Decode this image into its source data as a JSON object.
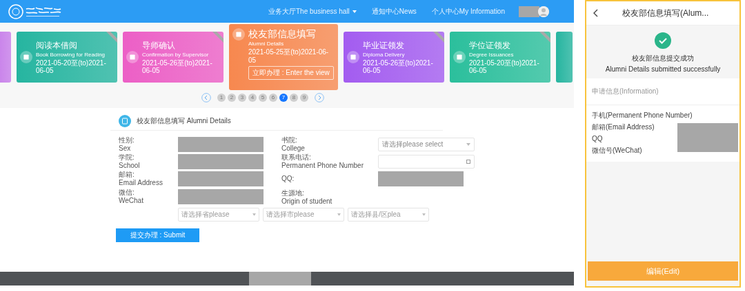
{
  "nav": {
    "items": [
      {
        "label": "业务大厅The business hall",
        "dropdown": true
      },
      {
        "label": "通知中心News",
        "dropdown": false
      },
      {
        "label": "个人中心My Information",
        "dropdown": false
      }
    ]
  },
  "carousel": {
    "cards": [
      {
        "kind": "fragment",
        "color": "#c77dea",
        "selected": false
      },
      {
        "title": "阅读本借阅",
        "subtitle": "Book Borrowing for Reading",
        "date": "2021-05-20至(to)2021-06-05",
        "color": "#26b5a0",
        "selected": false,
        "kind": "card"
      },
      {
        "title": "导师确认",
        "subtitle": "Confirmation by Supervisor",
        "date": "2021-05-26至(to)2021-06-05",
        "color": "#ec5fc6",
        "selected": false,
        "kind": "card"
      },
      {
        "title": "校友部信息填写",
        "subtitle": "Alumni Details",
        "date": "2021-05-25至(to)2021-06-05",
        "color": "#f7884f",
        "selected": true,
        "kind": "card",
        "action": "立即办理 : Enter the view"
      },
      {
        "title": "毕业证领发",
        "subtitle": "Diploma Delivery",
        "date": "2021-05-26至(to)2021-06-05",
        "color": "#a35cf0",
        "selected": false,
        "kind": "card"
      },
      {
        "title": "学位证领发",
        "subtitle": "Degree Issuances",
        "date": "2021-05-20至(to)2021-06-05",
        "color": "#2bbf9c",
        "selected": false,
        "kind": "card"
      },
      {
        "kind": "fragment",
        "color": "#26b5a0",
        "selected": false
      }
    ],
    "pages": [
      {
        "label": "1",
        "selected": false
      },
      {
        "label": "2",
        "selected": false
      },
      {
        "label": "3",
        "selected": false
      },
      {
        "label": "4",
        "selected": false
      },
      {
        "label": "5",
        "selected": false
      },
      {
        "label": "6",
        "selected": false
      },
      {
        "label": "7",
        "selected": true
      },
      {
        "label": "8",
        "selected": false
      },
      {
        "label": "9",
        "selected": false
      }
    ]
  },
  "form": {
    "title": "校友部信息填写 Alumni Details",
    "fields": [
      {
        "label": "性别:",
        "label_en": "Sex",
        "kind": "select",
        "redacted": true
      },
      {
        "label": "书院:",
        "label_en": "College",
        "kind": "select",
        "placeholder": "请选择please select",
        "redacted": false
      },
      {
        "label": "学院:",
        "label_en": "School",
        "kind": "select",
        "redacted": true
      },
      {
        "label": "联系电话:",
        "label_en": "Permanent Phone Number",
        "kind": "phone",
        "redacted": false
      },
      {
        "label": "邮箱:",
        "label_en": "Email Address",
        "kind": "input",
        "redacted": true
      },
      {
        "label": "QQ:",
        "kind": "input",
        "redacted": true
      },
      {
        "label": "微信:",
        "label_en": "WeChat",
        "kind": "input",
        "redacted": true
      }
    ],
    "origin": {
      "label": "生源地:",
      "label_en": "Origin of student",
      "selects": [
        "请选择省please",
        "请选择市please",
        "请选择县/区plea"
      ]
    },
    "submit": "提交办理 : Submit"
  },
  "mobile": {
    "title": "校友部信息填写(Alum...",
    "success": "校友部信息提交成功",
    "success_en": "Alumni Details submitted successfully",
    "section": "申请信息(Information)",
    "rows": [
      {
        "label": "手机(Permanent Phone Number)"
      },
      {
        "label": "邮箱(Email Address)"
      },
      {
        "label": "QQ"
      },
      {
        "label": "微信号(WeChat)"
      }
    ],
    "edit": "编辑(Edit)"
  }
}
